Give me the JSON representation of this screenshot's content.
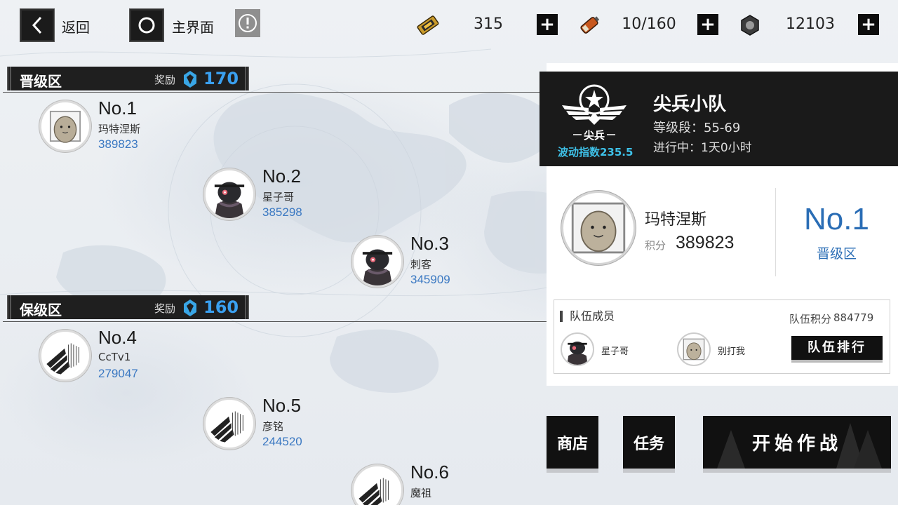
{
  "top": {
    "back_label": "返回",
    "home_label": "主界面",
    "resources": [
      {
        "icon": "ticket-icon",
        "value": "315"
      },
      {
        "icon": "battery-icon",
        "value": "10/160"
      },
      {
        "icon": "gear-nut-icon",
        "value": "12103"
      }
    ],
    "plus": "+"
  },
  "zones": [
    {
      "title": "晋级区",
      "reward_label": "奖励",
      "reward_value": "170"
    },
    {
      "title": "保级区",
      "reward_label": "奖励",
      "reward_value": "160"
    }
  ],
  "ranks": [
    {
      "no": "No.1",
      "name": "玛特涅斯",
      "score": "389823",
      "avatar": "potato"
    },
    {
      "no": "No.2",
      "name": "星子哥",
      "score": "385298",
      "avatar": "robot"
    },
    {
      "no": "No.3",
      "name": "刺客",
      "score": "345909",
      "avatar": "robot"
    },
    {
      "no": "No.4",
      "name": "CcTv1",
      "score": "279047",
      "avatar": "emblem"
    },
    {
      "no": "No.5",
      "name": "彦铭",
      "score": "244520",
      "avatar": "emblem"
    },
    {
      "no": "No.6",
      "name": "魔祖",
      "score": "",
      "avatar": "emblem"
    }
  ],
  "team": {
    "emblem_text": "尖兵",
    "wave_index": "波动指数235.5",
    "name": "尖兵小队",
    "level_range": "等级段：55-69",
    "progress": "进行中：1天0小时"
  },
  "me": {
    "name": "玛特涅斯",
    "score_label": "积分",
    "score": "389823",
    "rank": "No.1",
    "zone": "晋级区"
  },
  "members": {
    "title": "队伍成员",
    "score_label": "队伍积分",
    "score": "884779",
    "list": [
      {
        "name": "星子哥",
        "avatar": "robot"
      },
      {
        "name": "别打我",
        "avatar": "potato"
      }
    ],
    "rank_button": "队伍排行"
  },
  "buttons": {
    "shop": "商店",
    "tasks": "任务",
    "start": "开始作战"
  },
  "colors": {
    "accent_blue": "#3a78c2",
    "reward_blue": "#3aa0f0",
    "wave_cyan": "#3ec1e8",
    "dark": "#1a1a1a"
  }
}
